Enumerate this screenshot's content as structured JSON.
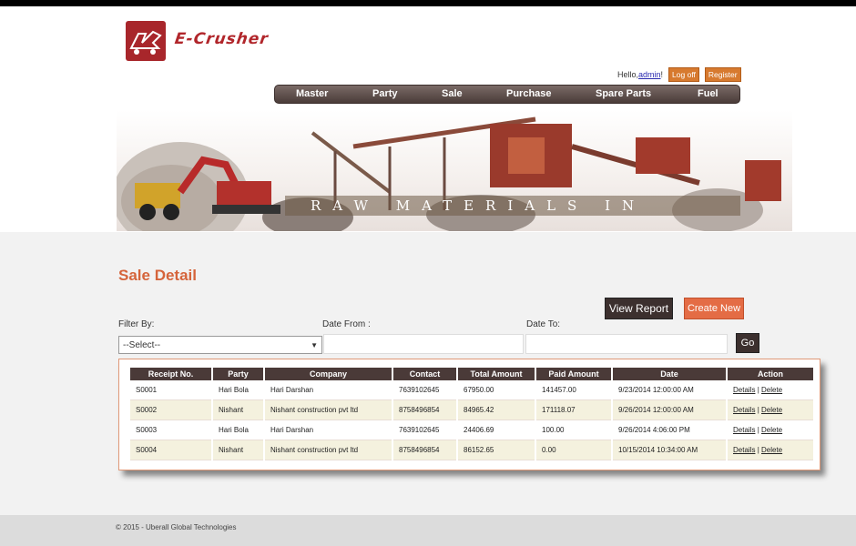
{
  "brand": {
    "name": "E-Crusher"
  },
  "user": {
    "hello": "Hello, ",
    "name": "admin",
    "suffix": "!",
    "logoff": "Log off",
    "register": "Register"
  },
  "nav": [
    "Master",
    "Party",
    "Sale",
    "Purchase",
    "Spare Parts",
    "Fuel"
  ],
  "banner": {
    "caption": "RAW MATERIALS IN"
  },
  "page": {
    "title": "Sale Detail"
  },
  "actions": {
    "view_report": "View Report",
    "create_new": "Create New",
    "go": "Go"
  },
  "filter": {
    "filter_by_label": "Filter By:",
    "date_from_label": "Date From :",
    "date_to_label": "Date To:",
    "select_value": "--Select--"
  },
  "table": {
    "columns": [
      "Receipt No.",
      "Party",
      "Company",
      "Contact",
      "Total Amount",
      "Paid Amount",
      "Date",
      "Action"
    ],
    "rows": [
      {
        "receipt": "S0001",
        "party": "Hari Bola",
        "company": "Hari Darshan",
        "contact": "7639102645",
        "total": "67950.00",
        "paid": "141457.00",
        "date": "9/23/2014 12:00:00 AM"
      },
      {
        "receipt": "S0002",
        "party": "Nishant",
        "company": "Nishant construction pvt ltd",
        "contact": "8758496854",
        "total": "84965.42",
        "paid": "171118.07",
        "date": "9/26/2014 12:00:00 AM"
      },
      {
        "receipt": "S0003",
        "party": "Hari Bola",
        "company": "Hari Darshan",
        "contact": "7639102645",
        "total": "24406.69",
        "paid": "100.00",
        "date": "9/26/2014 4:06:00 PM"
      },
      {
        "receipt": "S0004",
        "party": "Nishant",
        "company": "Nishant construction pvt ltd",
        "contact": "8758496854",
        "total": "86152.65",
        "paid": "0.00",
        "date": "10/15/2014 10:34:00 AM"
      }
    ],
    "details_label": "Details",
    "separator": "|",
    "delete_label": "Delete"
  },
  "footer": {
    "text": "© 2015 - Uberall Global Technologies"
  },
  "colors": {
    "accent": "#d5643b",
    "nav_bg": "#4a3c39",
    "table_header": "#4a3a38",
    "alt_row": "#f4f1de"
  }
}
